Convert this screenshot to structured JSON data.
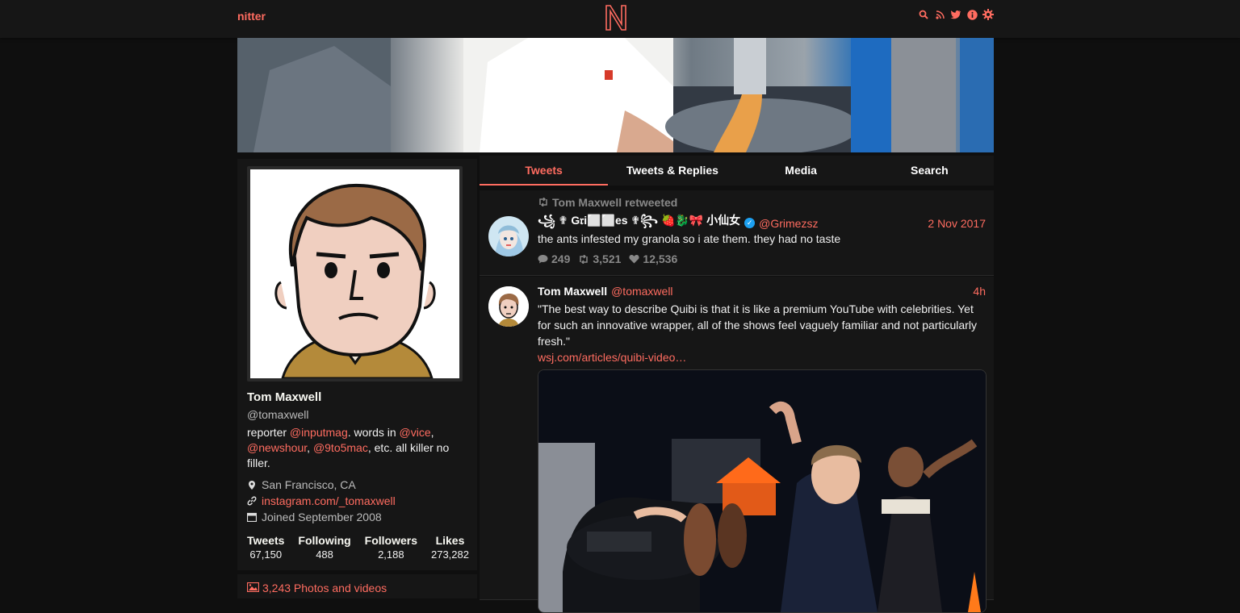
{
  "nav": {
    "brand": "nitter",
    "icons": [
      "search-icon",
      "rss-icon",
      "twitter-icon",
      "info-icon",
      "gear-icon"
    ],
    "accent": "#ff6c60"
  },
  "profile": {
    "name": "Tom Maxwell",
    "handle": "@tomaxwell",
    "bio": {
      "p1": "reporter ",
      "link1": "@inputmag",
      "p2": ". words in ",
      "link2": "@vice",
      "p3": ", ",
      "link3": "@newshour",
      "p4": ", ",
      "link4": "@9to5mac",
      "p5": ", etc. all killer no filler."
    },
    "location": "San Francisco, CA",
    "website": "instagram.com/_tomaxwell",
    "joined": "Joined September 2008",
    "stats": [
      {
        "label": "Tweets",
        "value": "67,150"
      },
      {
        "label": "Following",
        "value": "488"
      },
      {
        "label": "Followers",
        "value": "2,188"
      },
      {
        "label": "Likes",
        "value": "273,282"
      }
    ],
    "photos": "3,243 Photos and videos"
  },
  "tabs": [
    "Tweets",
    "Tweets & Replies",
    "Media",
    "Search"
  ],
  "tweets": [
    {
      "retweet_header": "Tom Maxwell retweeted",
      "name": "꧁ ✟ G𝔯i⬜⬜es ✟꧂ 🍓🐉🎀 小仙女",
      "handle": "@Grimezsz",
      "date": "2 Nov 2017",
      "text": "the ants infested my granola so i ate them.  they had no taste",
      "replies": "249",
      "retweets": "3,521",
      "likes": "12,536"
    },
    {
      "name": "Tom Maxwell",
      "handle": "@tomaxwell",
      "date": "4h",
      "text": "\"The best way to describe Quibi is that it is like a premium YouTube with celebrities. Yet for such an innovative wrapper, all of the shows feel vaguely familiar and not particularly fresh.\"",
      "link": "wsj.com/articles/quibi-video…"
    }
  ]
}
